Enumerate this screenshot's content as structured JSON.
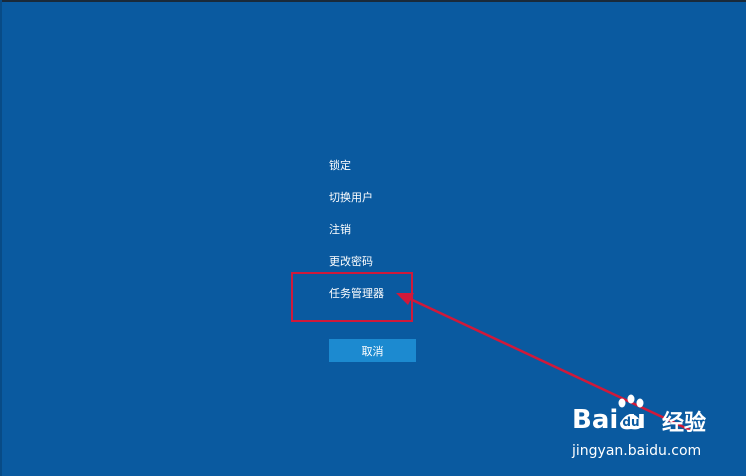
{
  "menu": {
    "items": [
      {
        "label": "锁定"
      },
      {
        "label": "切换用户"
      },
      {
        "label": "注销"
      },
      {
        "label": "更改密码"
      },
      {
        "label": "任务管理器"
      }
    ]
  },
  "cancel_label": "取消",
  "watermark": {
    "logo": "Bai  u",
    "brand": "经验",
    "url": "jingyan.baidu.com"
  },
  "colors": {
    "background": "#0a5aa0",
    "button": "#1c8ad0",
    "annotation": "#d0193a"
  }
}
